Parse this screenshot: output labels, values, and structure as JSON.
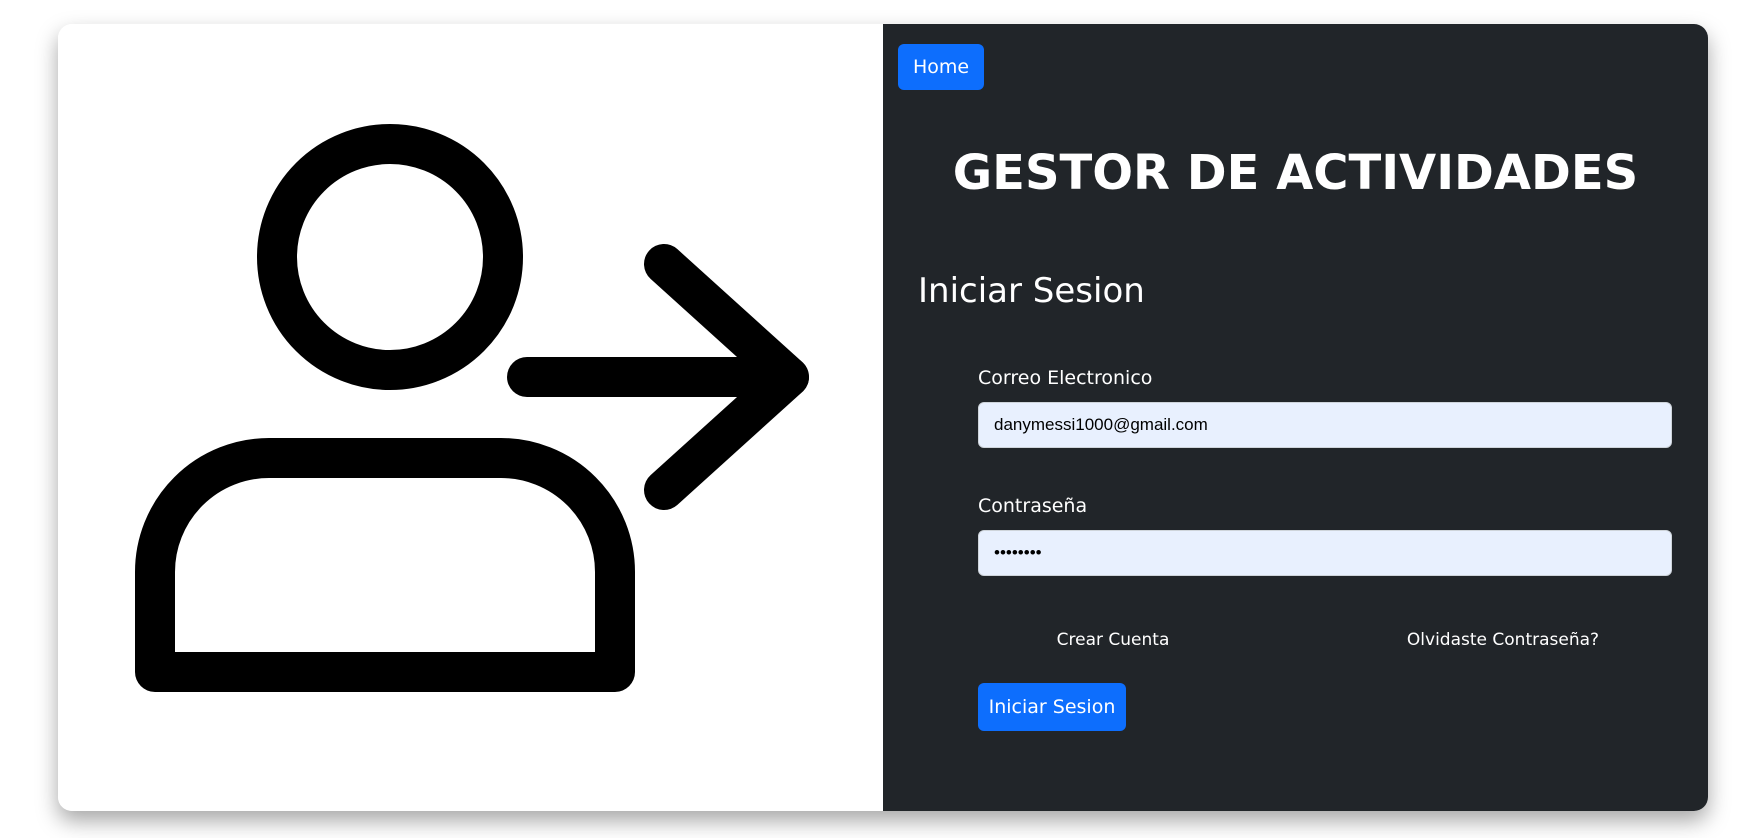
{
  "illustration": {
    "icon": "user-login-arrow-icon"
  },
  "nav": {
    "home_label": "Home"
  },
  "header": {
    "title": "GESTOR DE ACTIVIDADES"
  },
  "form": {
    "title": "Iniciar Sesion",
    "email_label": "Correo Electronico",
    "email_value": "danymessi1000@gmail.com",
    "password_label": "Contraseña",
    "password_value": "********",
    "create_account_label": "Crear Cuenta",
    "forgot_password_label": "Olvidaste Contraseña?",
    "submit_label": "Iniciar Sesion"
  },
  "colors": {
    "panel_dark": "#212529",
    "accent": "#0d6efd",
    "input_bg": "#e8f0fe"
  }
}
